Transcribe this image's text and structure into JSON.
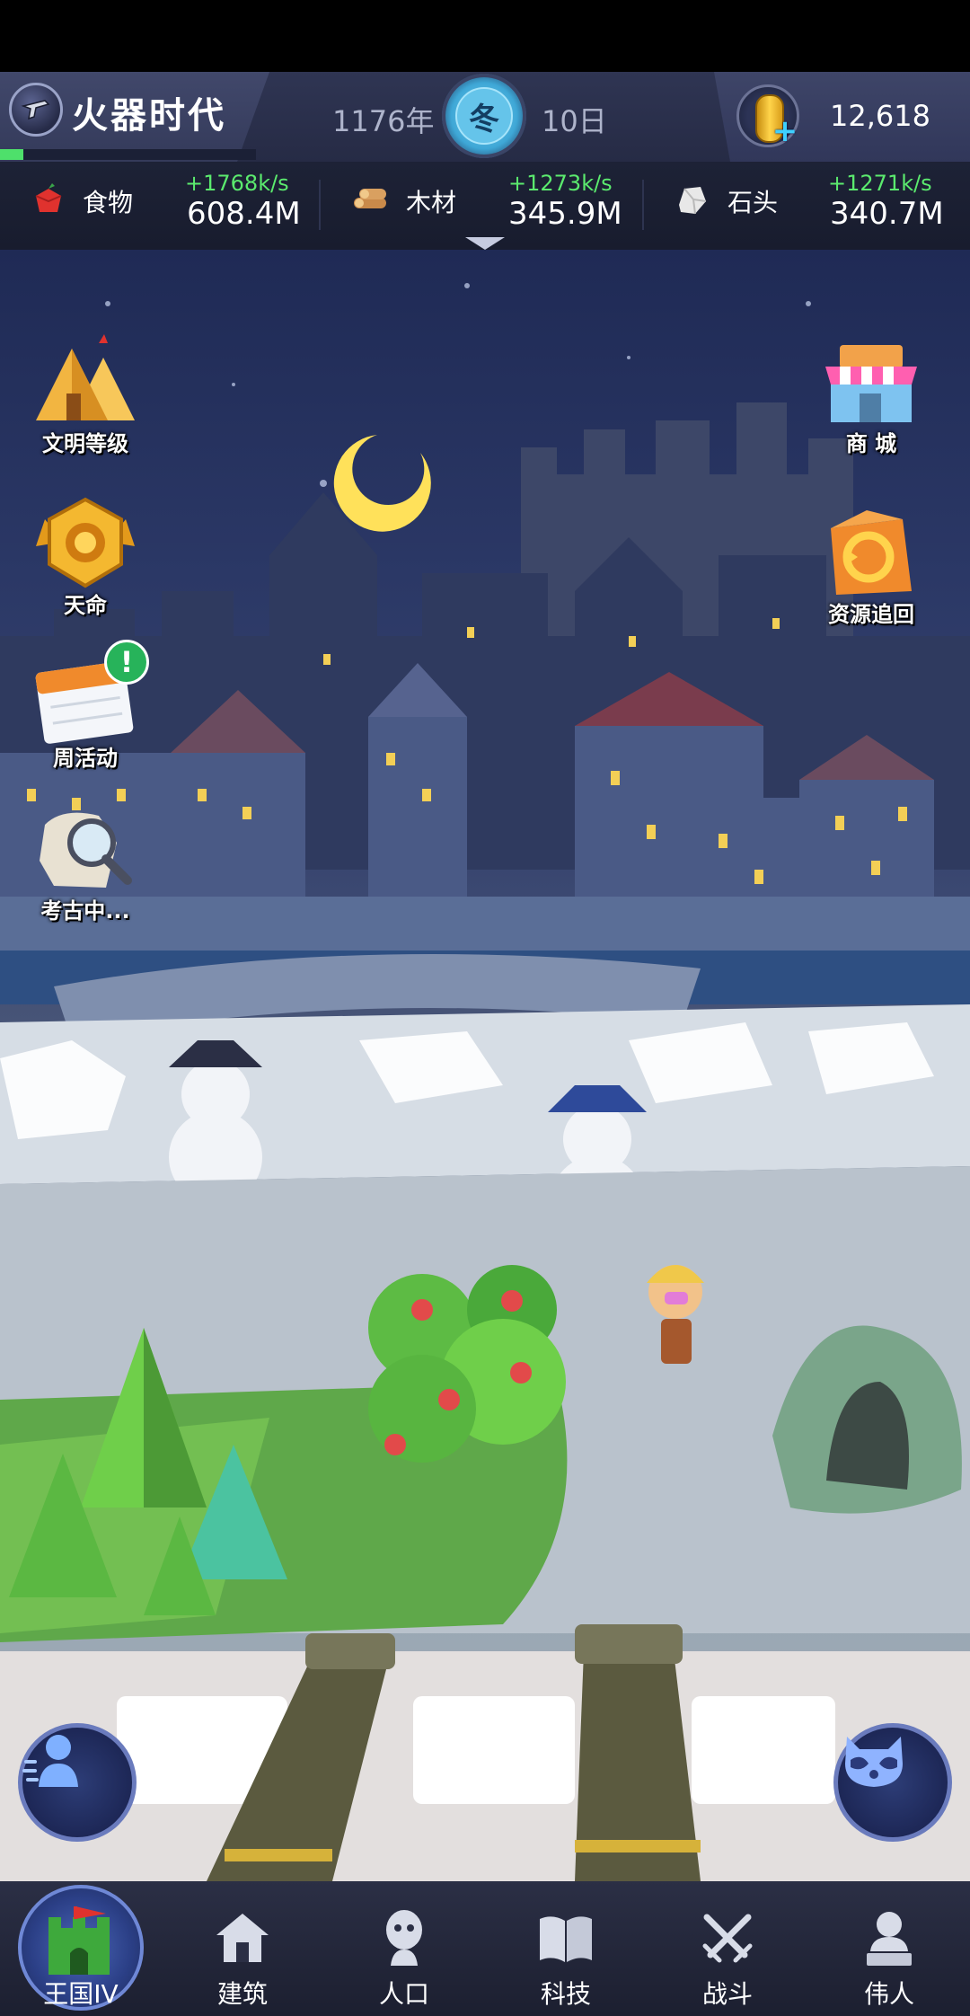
{
  "header": {
    "era_title": "火器时代",
    "era_progress": 0.09,
    "year": "1176年",
    "season": "冬",
    "day": "10日",
    "coins": "12,618"
  },
  "resources": [
    {
      "icon": "food-icon",
      "label": "食物",
      "rate": "+1768k/s",
      "amount": "608.4M"
    },
    {
      "icon": "wood-icon",
      "label": "木材",
      "rate": "+1273k/s",
      "amount": "345.9M"
    },
    {
      "icon": "stone-icon",
      "label": "石头",
      "rate": "+1271k/s",
      "amount": "340.7M"
    }
  ],
  "side_left": [
    {
      "label": "文明等级",
      "icon": "civilization-pyramid-icon"
    },
    {
      "label": "天命",
      "icon": "destiny-badge-icon"
    },
    {
      "label": "周活动",
      "icon": "weekly-calendar-icon"
    },
    {
      "label": "考古中...",
      "icon": "archaeology-magnifier-icon"
    }
  ],
  "side_right": [
    {
      "label": "商 城",
      "icon": "shop-icon"
    },
    {
      "label": "资源追回",
      "icon": "resource-recover-icon"
    }
  ],
  "nav": [
    {
      "label": "王国IV",
      "icon": "castle-icon",
      "active": true
    },
    {
      "label": "建筑",
      "icon": "house-icon"
    },
    {
      "label": "人口",
      "icon": "population-icon"
    },
    {
      "label": "科技",
      "icon": "book-icon"
    },
    {
      "label": "战斗",
      "icon": "crossed-swords-icon"
    },
    {
      "label": "伟人",
      "icon": "bust-icon"
    }
  ],
  "colors": {
    "rate_green": "#5bea6e",
    "header_bg": "#2f3553",
    "nav_bg": "#1c1f30",
    "progress_green": "#4ee06b"
  }
}
